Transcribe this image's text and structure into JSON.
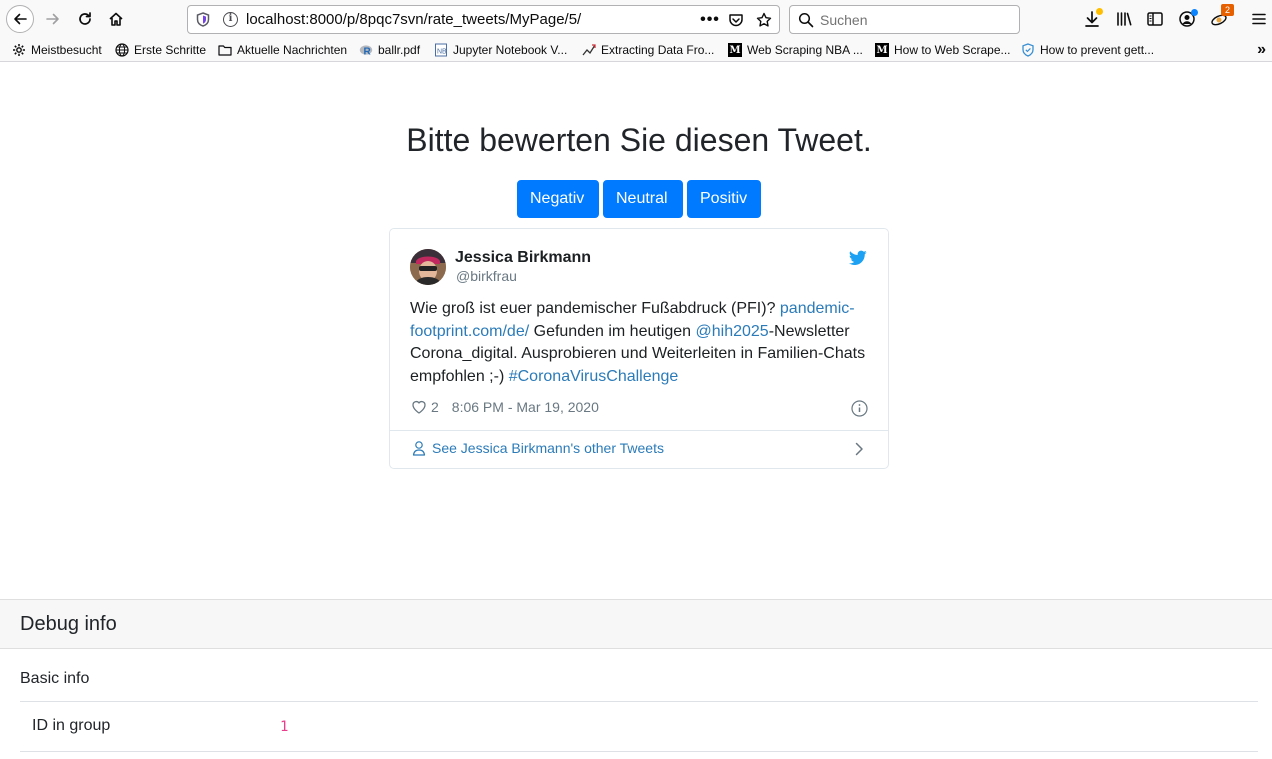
{
  "browser": {
    "url_host": "localhost",
    "url_path": ":8000/p/8pqc7svn/rate_tweets/MyPage/5/",
    "url_more": "•••",
    "search_placeholder": "Suchen",
    "extension_badge": "2",
    "bookmarks": [
      {
        "label": "Meistbesucht",
        "icon": "gear-icon"
      },
      {
        "label": "Erste Schritte",
        "icon": "globe-icon"
      },
      {
        "label": "Aktuelle Nachrichten",
        "icon": "folder-icon"
      },
      {
        "label": "ballr.pdf",
        "icon": "r-logo-icon"
      },
      {
        "label": "Jupyter Notebook V...",
        "icon": "notebook-icon"
      },
      {
        "label": "Extracting Data Fro...",
        "icon": "chart-icon"
      },
      {
        "label": "Web Scraping NBA ...",
        "icon": "medium-icon"
      },
      {
        "label": "How to Web Scrape...",
        "icon": "medium-icon"
      },
      {
        "label": "How to prevent gett...",
        "icon": "shield-icon"
      }
    ],
    "bookmark_overflow": "»"
  },
  "page": {
    "title": "Bitte bewerten Sie diesen Tweet.",
    "buttons": {
      "negative": "Negativ",
      "neutral": "Neutral",
      "positive": "Positiv"
    }
  },
  "tweet": {
    "name": "Jessica Birkmann",
    "handle": "@birkfrau",
    "text_1": "Wie groß ist euer pandemischer Fußabdruck (PFI)? ",
    "link_1": "pandemic-footprint.com/de/",
    "text_2": " Gefunden im heutigen ",
    "link_2": "@hih2025",
    "text_3": "-Newsletter Corona_digital. Ausprobieren und Weiterleiten in Familien-Chats empfohlen ;-) ",
    "link_3": "#CoronaVirusChallenge",
    "likes": "2",
    "timestamp": "8:06 PM - Mar 19, 2020",
    "more_link": "See Jessica Birkmann's other Tweets",
    "colors": {
      "link": "#2b7bb9",
      "twitter_blue": "#1da1f2"
    }
  },
  "debug": {
    "title": "Debug info",
    "section": "Basic info",
    "rows": [
      {
        "label": "ID in group",
        "value": "1"
      }
    ]
  },
  "colors": {
    "primary": "#007bff",
    "code": "#e83e8c"
  }
}
